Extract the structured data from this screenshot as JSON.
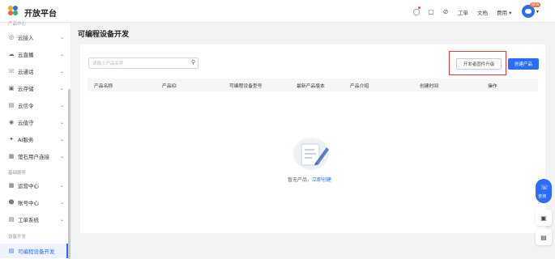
{
  "header": {
    "brand": "开放平台",
    "links": {
      "ticket": "工单",
      "docs": "文档",
      "fees": "费用"
    },
    "vip_badge": "NEW",
    "icons": [
      "bulb-icon",
      "tablet-icon",
      "compass-icon"
    ]
  },
  "sidebar": {
    "section_top": "产品中心",
    "section_basic": "基础服务",
    "section_dev": "设备开发",
    "items": [
      {
        "label": "云接入",
        "icon": "cloud-access-icon"
      },
      {
        "label": "云直播",
        "icon": "live-icon"
      },
      {
        "label": "云通话",
        "icon": "call-icon"
      },
      {
        "label": "云存储",
        "icon": "storage-icon"
      },
      {
        "label": "云信令",
        "icon": "signal-icon"
      },
      {
        "label": "云值守",
        "icon": "camera-icon"
      },
      {
        "label": "AI服务",
        "icon": "ai-icon"
      },
      {
        "label": "萤石用户连接",
        "icon": "user-connect-icon"
      }
    ],
    "basic_items": [
      {
        "label": "运营中心",
        "icon": "ops-icon"
      },
      {
        "label": "账号中心",
        "icon": "account-icon"
      },
      {
        "label": "工单系统",
        "icon": "ticket-icon"
      }
    ],
    "dev_items": [
      {
        "label": "可编程设备开发",
        "icon": "dev-icon"
      }
    ]
  },
  "main": {
    "title": "可编程设备开发",
    "search_placeholder": "请输入产品名称",
    "btn_upgrade": "开发者固件升级",
    "btn_create": "创建产品",
    "columns": [
      "产品名称",
      "产品ID",
      "可编程设备型号",
      "最新产品版本",
      "产品介绍",
      "创建时间",
      "操作"
    ],
    "empty_text": "暂无产品，",
    "empty_link": "立即创建"
  },
  "float": {
    "consult": "咨询"
  },
  "colors": {
    "accent": "#2d6cf6",
    "highlight": "#e53935"
  }
}
